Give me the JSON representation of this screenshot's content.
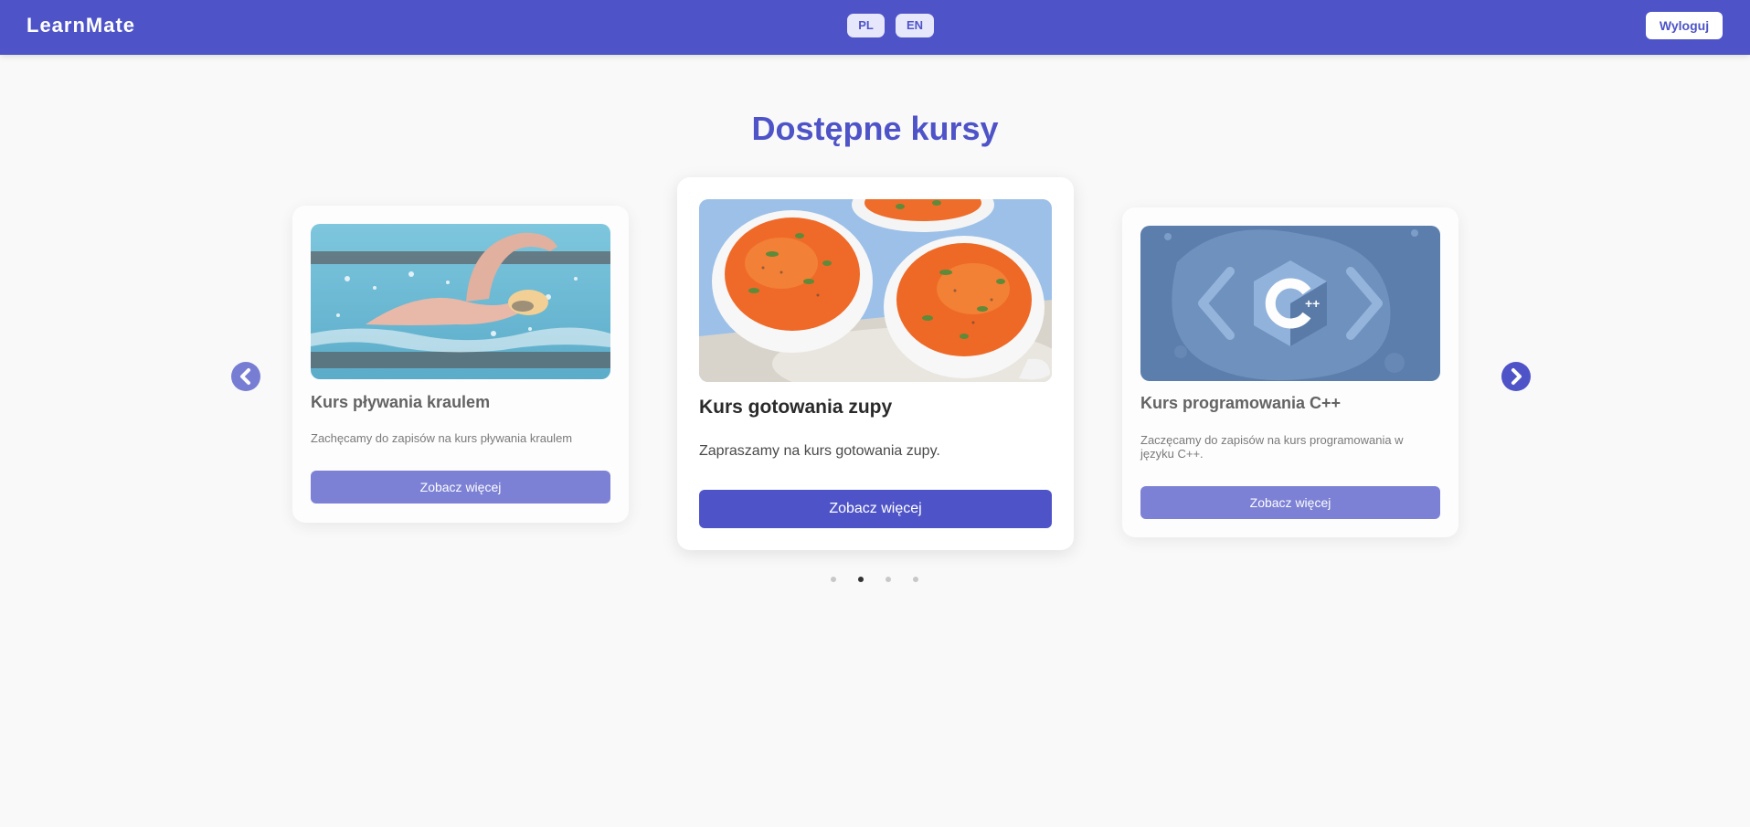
{
  "header": {
    "brand": "LearnMate",
    "languages": [
      "PL",
      "EN"
    ],
    "logout_label": "Wyloguj"
  },
  "colors": {
    "accent": "#4e54c8",
    "background": "#f9f9f9"
  },
  "main": {
    "heading": "Dostępne kursy",
    "carousel": {
      "cards": [
        {
          "title": "Kurs pływania kraulem",
          "description": "Zachęcamy do zapisów na kurs pływania kraulem",
          "button_label": "Zobacz więcej",
          "image": "swimmer-photo"
        },
        {
          "title": "Kurs gotowania zupy",
          "description": "Zapraszamy na kurs gotowania zupy.",
          "button_label": "Zobacz więcej",
          "image": "tomato-soup-photo"
        },
        {
          "title": "Kurs programowania C++",
          "description": "Zaczęcamy do zapisów na kurs programowania w języku C++.",
          "button_label": "Zobacz więcej",
          "image": "cpp-logo-illustration"
        }
      ],
      "prev_icon": "chevron-left-icon",
      "next_icon": "chevron-right-icon",
      "dot_count": 4,
      "active_dot": 2
    }
  }
}
